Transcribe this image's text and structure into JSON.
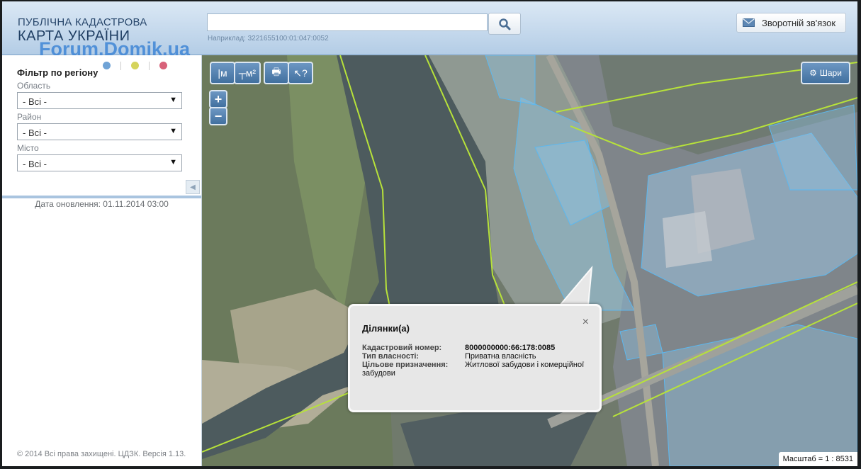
{
  "header": {
    "logo_line1": "ПУБЛІЧНА КАДАСТРОВА",
    "logo_line2": "КАРТА УКРАЇНИ",
    "watermark": "Forum.Domik.ua",
    "search": {
      "value": "",
      "hint": "Наприклад: 3221655100:01:047:0052"
    },
    "feedback_label": "Зворотній зв'язок"
  },
  "colors": {
    "header_top": "#dbe8f5",
    "header_bottom": "#b4cde6",
    "tool_blue": "#4f7fb0",
    "parcel_outline": "#5bb8f0",
    "boundary_line": "#b7e23a",
    "dot_blue": "#6fa3d6",
    "dot_yellow": "#d5d45c",
    "dot_red": "#d8627a"
  },
  "sidebar": {
    "filter_title": "Фільтр по регіону",
    "fields": [
      {
        "label": "Область",
        "value": "- Всі -"
      },
      {
        "label": "Район",
        "value": "- Всі -"
      },
      {
        "label": "Місто",
        "value": "- Всі -"
      }
    ],
    "update_text": "Дата оновлення: 01.11.2014 03:00",
    "copyright": "© 2014 Всі права захищені. ЦДЗК. Версія 1.13."
  },
  "map": {
    "tools": [
      {
        "name": "measure-length-icon",
        "glyph": "|м"
      },
      {
        "name": "measure-area-icon",
        "glyph": "┬м²"
      },
      {
        "name": "print-icon",
        "glyph": "🖶"
      },
      {
        "name": "identify-icon",
        "glyph": "↖?"
      }
    ],
    "layers_button": "Шари",
    "zoom_in": "+",
    "zoom_out": "−",
    "scale_text": "Масштаб = 1 : 8531",
    "popup": {
      "title": "Ділянки(а)",
      "close_glyph": "×",
      "rows": [
        {
          "key": "Кадастровий номер:",
          "value": "8000000000:66:178:0085"
        },
        {
          "key": "Тип власності:",
          "value": "Приватна власність"
        },
        {
          "key": "Цільове призначення:",
          "value": "Житлової забудови і комерційної забудови"
        }
      ]
    }
  }
}
